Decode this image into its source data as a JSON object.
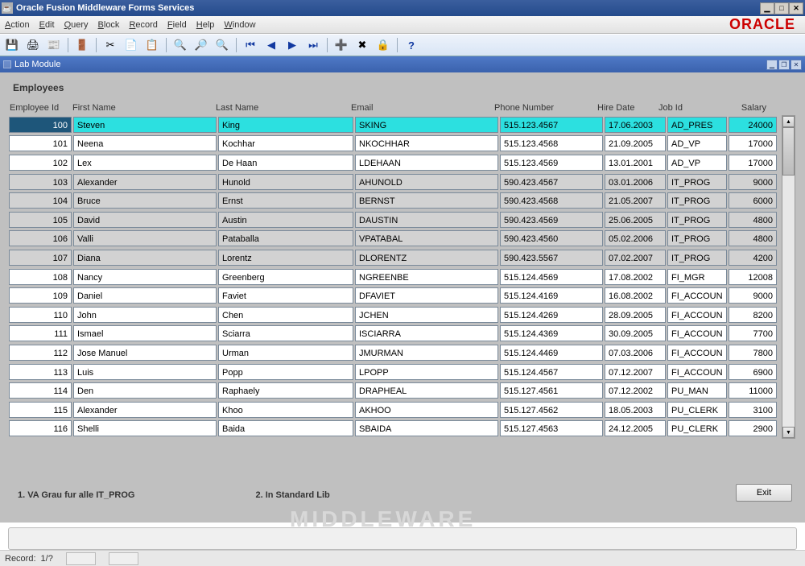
{
  "window": {
    "title": "Oracle Fusion Middleware Forms Services"
  },
  "brand": "ORACLE",
  "menu": {
    "action": "Action",
    "edit": "Edit",
    "query": "Query",
    "block": "Block",
    "record": "Record",
    "field": "Field",
    "help": "Help",
    "window": "Window"
  },
  "module": {
    "title": "Lab Module"
  },
  "section": {
    "title": "Employees"
  },
  "columns": {
    "id": "Employee Id",
    "fn": "First Name",
    "ln": "Last Name",
    "em": "Email",
    "ph": "Phone Number",
    "hd": "Hire Date",
    "jb": "Job Id",
    "sa": "Salary"
  },
  "notes": {
    "n1": "1. VA Grau fur alle IT_PROG",
    "n2": "2. In Standard Lib"
  },
  "buttons": {
    "exit": "Exit"
  },
  "status": {
    "record_label": "Record:",
    "record_value": "1/?",
    "ghost": "MIDDLEWARE"
  },
  "rows": [
    {
      "id": "100",
      "fn": "Steven",
      "ln": "King",
      "em": "SKING",
      "ph": "515.123.4567",
      "hd": "17.06.2003",
      "jb": "AD_PRES",
      "sa": "24000",
      "sel": true,
      "shade": "white"
    },
    {
      "id": "101",
      "fn": "Neena",
      "ln": "Kochhar",
      "em": "NKOCHHAR",
      "ph": "515.123.4568",
      "hd": "21.09.2005",
      "jb": "AD_VP",
      "sa": "17000",
      "shade": "white"
    },
    {
      "id": "102",
      "fn": "Lex",
      "ln": "De Haan",
      "em": "LDEHAAN",
      "ph": "515.123.4569",
      "hd": "13.01.2001",
      "jb": "AD_VP",
      "sa": "17000",
      "shade": "white"
    },
    {
      "id": "103",
      "fn": "Alexander",
      "ln": "Hunold",
      "em": "AHUNOLD",
      "ph": "590.423.4567",
      "hd": "03.01.2006",
      "jb": "IT_PROG",
      "sa": "9000",
      "shade": "gray"
    },
    {
      "id": "104",
      "fn": "Bruce",
      "ln": "Ernst",
      "em": "BERNST",
      "ph": "590.423.4568",
      "hd": "21.05.2007",
      "jb": "IT_PROG",
      "sa": "6000",
      "shade": "gray"
    },
    {
      "id": "105",
      "fn": "David",
      "ln": "Austin",
      "em": "DAUSTIN",
      "ph": "590.423.4569",
      "hd": "25.06.2005",
      "jb": "IT_PROG",
      "sa": "4800",
      "shade": "gray"
    },
    {
      "id": "106",
      "fn": "Valli",
      "ln": "Pataballa",
      "em": "VPATABAL",
      "ph": "590.423.4560",
      "hd": "05.02.2006",
      "jb": "IT_PROG",
      "sa": "4800",
      "shade": "gray"
    },
    {
      "id": "107",
      "fn": "Diana",
      "ln": "Lorentz",
      "em": "DLORENTZ",
      "ph": "590.423.5567",
      "hd": "07.02.2007",
      "jb": "IT_PROG",
      "sa": "4200",
      "shade": "gray"
    },
    {
      "id": "108",
      "fn": "Nancy",
      "ln": "Greenberg",
      "em": "NGREENBE",
      "ph": "515.124.4569",
      "hd": "17.08.2002",
      "jb": "FI_MGR",
      "sa": "12008",
      "shade": "white"
    },
    {
      "id": "109",
      "fn": "Daniel",
      "ln": "Faviet",
      "em": "DFAVIET",
      "ph": "515.124.4169",
      "hd": "16.08.2002",
      "jb": "FI_ACCOUN",
      "sa": "9000",
      "shade": "white"
    },
    {
      "id": "110",
      "fn": "John",
      "ln": "Chen",
      "em": "JCHEN",
      "ph": "515.124.4269",
      "hd": "28.09.2005",
      "jb": "FI_ACCOUN",
      "sa": "8200",
      "shade": "white"
    },
    {
      "id": "111",
      "fn": "Ismael",
      "ln": "Sciarra",
      "em": "ISCIARRA",
      "ph": "515.124.4369",
      "hd": "30.09.2005",
      "jb": "FI_ACCOUN",
      "sa": "7700",
      "shade": "white"
    },
    {
      "id": "112",
      "fn": "Jose Manuel",
      "ln": "Urman",
      "em": "JMURMAN",
      "ph": "515.124.4469",
      "hd": "07.03.2006",
      "jb": "FI_ACCOUN",
      "sa": "7800",
      "shade": "white"
    },
    {
      "id": "113",
      "fn": "Luis",
      "ln": "Popp",
      "em": "LPOPP",
      "ph": "515.124.4567",
      "hd": "07.12.2007",
      "jb": "FI_ACCOUN",
      "sa": "6900",
      "shade": "white"
    },
    {
      "id": "114",
      "fn": "Den",
      "ln": "Raphaely",
      "em": "DRAPHEAL",
      "ph": "515.127.4561",
      "hd": "07.12.2002",
      "jb": "PU_MAN",
      "sa": "11000",
      "shade": "white"
    },
    {
      "id": "115",
      "fn": "Alexander",
      "ln": "Khoo",
      "em": "AKHOO",
      "ph": "515.127.4562",
      "hd": "18.05.2003",
      "jb": "PU_CLERK",
      "sa": "3100",
      "shade": "white"
    },
    {
      "id": "116",
      "fn": "Shelli",
      "ln": "Baida",
      "em": "SBAIDA",
      "ph": "515.127.4563",
      "hd": "24.12.2005",
      "jb": "PU_CLERK",
      "sa": "2900",
      "shade": "white"
    }
  ]
}
